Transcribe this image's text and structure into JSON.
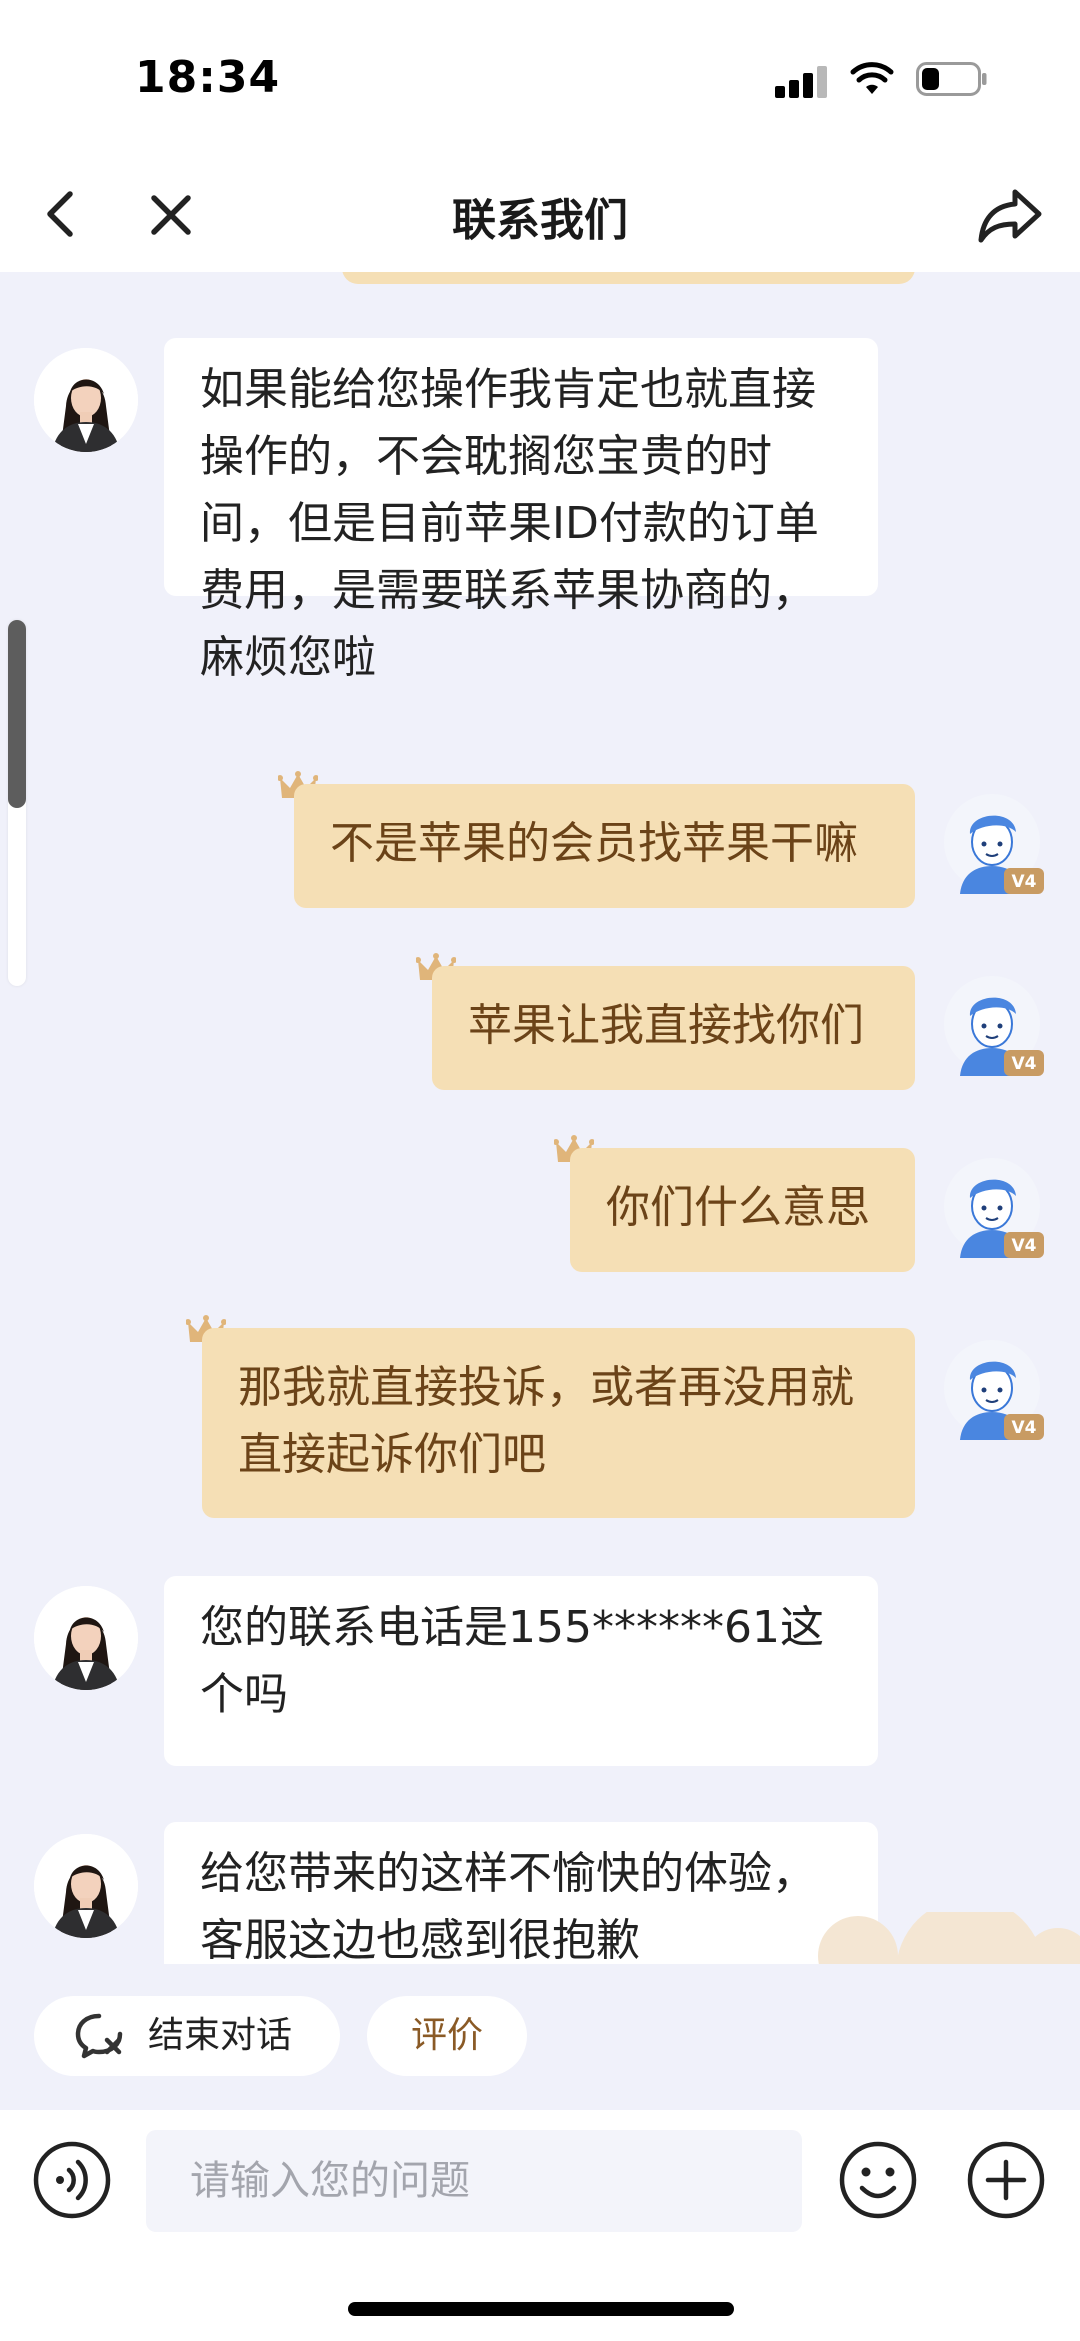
{
  "status_bar": {
    "time": "18:34"
  },
  "nav": {
    "title": "联系我们"
  },
  "messages": [
    {
      "sender": "agent",
      "lines": [
        "如果能给您操作我肯定也就直接",
        "操作的，不会耽搁您宝贵的时",
        "间，但是目前苹果ID付款的订单",
        "费用，是需要联系苹果协商的，",
        "麻烦您啦"
      ]
    },
    {
      "sender": "user",
      "lines": [
        "不是苹果的会员找苹果干嘛"
      ],
      "badge": "V4"
    },
    {
      "sender": "user",
      "lines": [
        "苹果让我直接找你们"
      ],
      "badge": "V4"
    },
    {
      "sender": "user",
      "lines": [
        "你们什么意思"
      ],
      "badge": "V4"
    },
    {
      "sender": "user",
      "lines": [
        "那我就直接投诉，或者再没用就",
        "直接起诉你们吧"
      ],
      "badge": "V4"
    },
    {
      "sender": "agent",
      "lines": [
        "您的联系电话是155******61这",
        "个吗"
      ]
    },
    {
      "sender": "agent",
      "lines": [
        "给您带来的这样不愉快的体验，",
        "客服这边也感到很抱歉"
      ]
    }
  ],
  "quick_actions": {
    "end_chat": "结束对话",
    "rate": "评价"
  },
  "input": {
    "placeholder": "请输入您的问题"
  },
  "colors": {
    "user_bubble": "#f5dfb5",
    "user_text": "#6b4318",
    "chat_bg": "#f0f1fa",
    "agent_bubble": "#ffffff"
  },
  "icons": [
    "back-icon",
    "close-icon",
    "share-icon",
    "voice-icon",
    "emoji-icon",
    "plus-icon",
    "end-chat-icon",
    "crown-icon"
  ]
}
